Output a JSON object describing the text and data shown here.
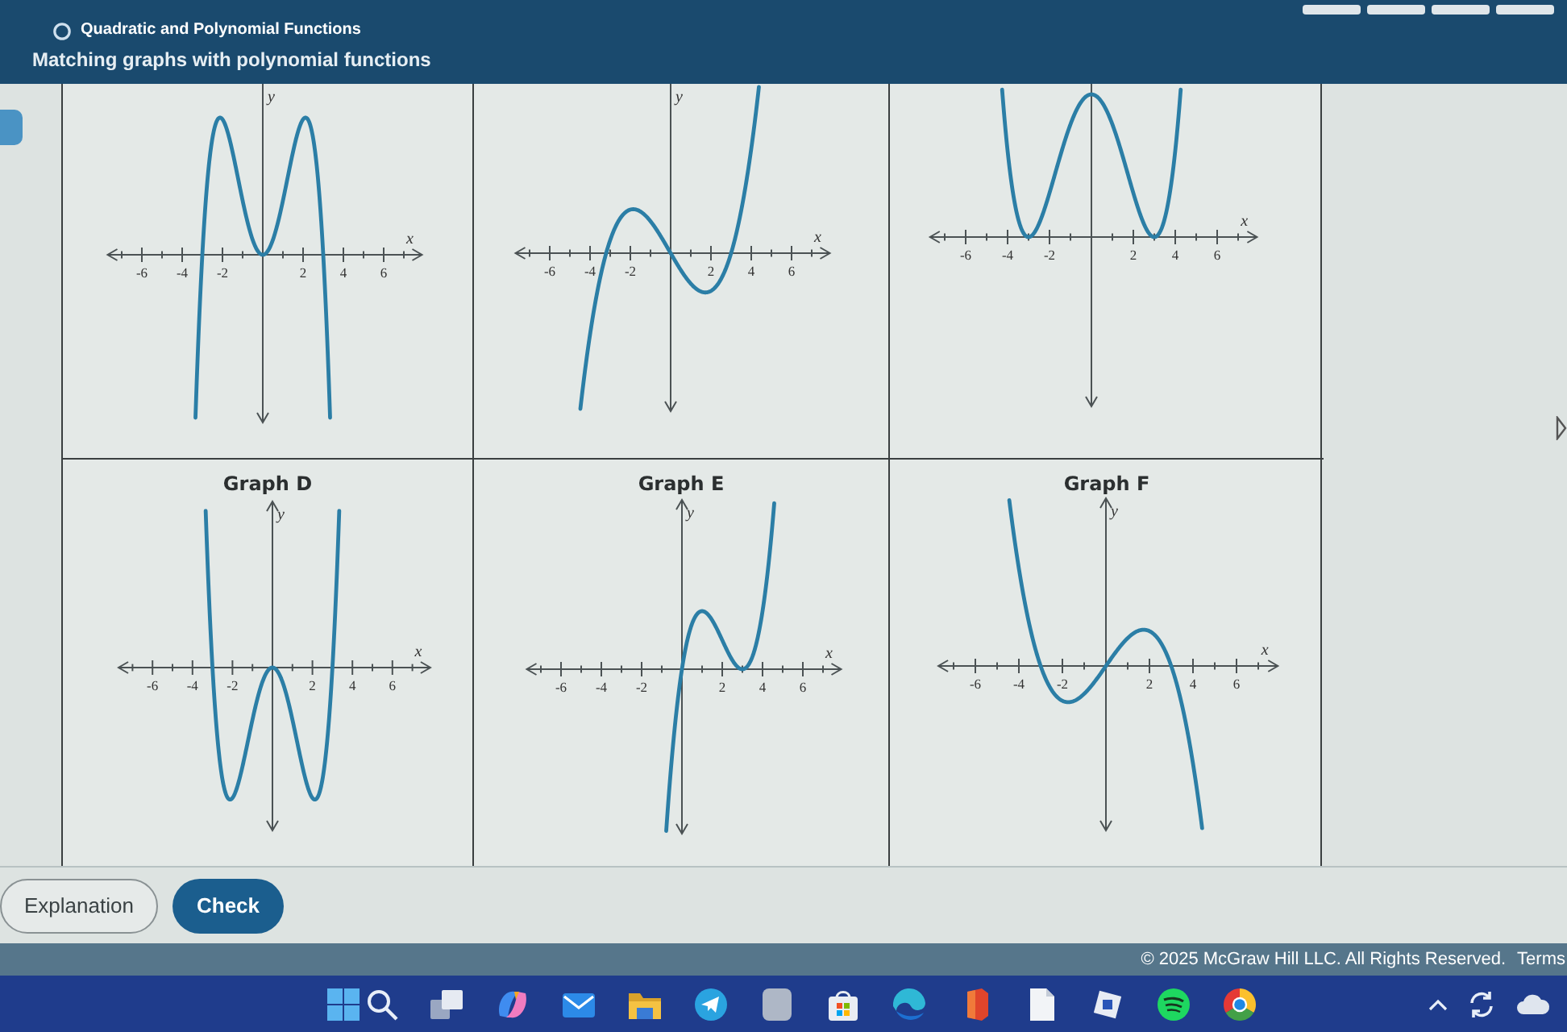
{
  "header": {
    "topic": "Quadratic and Polynomial Functions",
    "title": "Matching graphs with polynomial functions"
  },
  "graphs": [
    {
      "x_label": "x",
      "y_label": "y",
      "tick_labels": [
        "-6",
        "-4",
        "-2",
        "2",
        "4",
        "6"
      ]
    },
    {
      "x_label": "x",
      "y_label": "y",
      "tick_labels": [
        "-6",
        "-4",
        "-2",
        "2",
        "4",
        "6"
      ]
    },
    {
      "x_label": "x",
      "tick_labels": [
        "-6",
        "-4",
        "-2",
        "2",
        "4",
        "6"
      ]
    },
    {
      "title": "Graph D",
      "x_label": "x",
      "y_label": "y",
      "tick_labels": [
        "-6",
        "-4",
        "-2",
        "2",
        "4",
        "6"
      ]
    },
    {
      "title": "Graph E",
      "x_label": "x",
      "y_label": "y",
      "tick_labels": [
        "-6",
        "-4",
        "-2",
        "2",
        "4",
        "6"
      ]
    },
    {
      "title": "Graph F",
      "x_label": "x",
      "y_label": "y",
      "tick_labels": [
        "-6",
        "-4",
        "-2",
        "2",
        "4",
        "6"
      ]
    }
  ],
  "buttons": [
    {
      "label": "Explanation",
      "kind": "secondary"
    },
    {
      "label": "Check",
      "kind": "primary"
    }
  ],
  "footer": {
    "copyright": "© 2025 McGraw Hill LLC. All Rights Reserved.",
    "link": "Terms"
  }
}
